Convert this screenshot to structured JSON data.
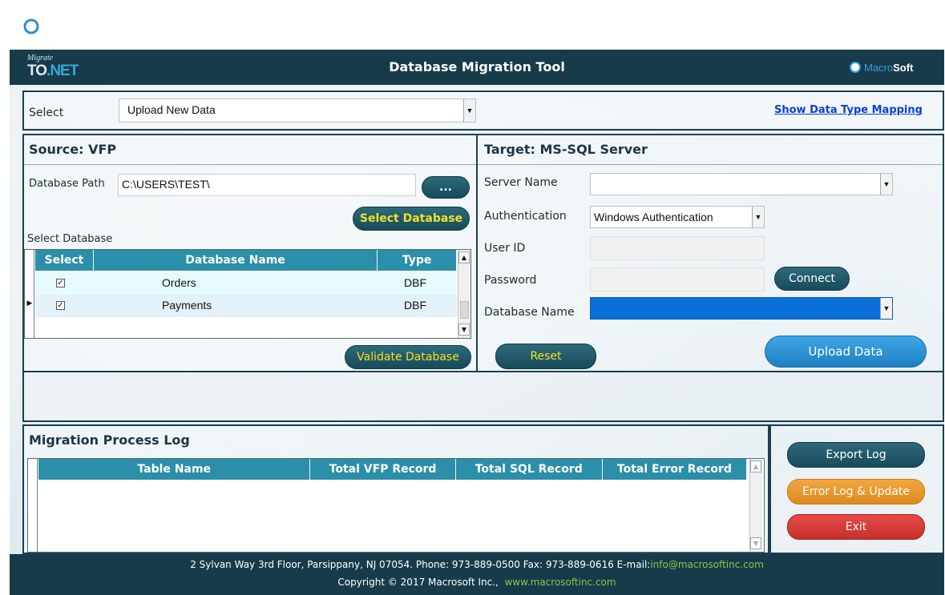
{
  "header": {
    "logo_line1": "Migrate",
    "logo_line2a": "TO",
    "logo_line2b": ".NET",
    "title": "Database Migration Tool",
    "brand_a": "Macro",
    "brand_b": "Soft"
  },
  "top_bar": {
    "select_label": "Select",
    "select_value": "Upload New Data",
    "mapping_link": "Show Data Type Mapping"
  },
  "source": {
    "title": "Source: VFP",
    "db_path_label": "Database Path",
    "db_path_value": "C:\\USERS\\TEST\\",
    "browse_label": "...",
    "select_db_button": "Select Database",
    "select_db_label": "Select Database",
    "columns": [
      "Select",
      "Database Name",
      "Type"
    ],
    "rows": [
      {
        "checked": true,
        "name": "Orders",
        "type": "DBF"
      },
      {
        "checked": true,
        "name": "Payments",
        "type": "DBF"
      }
    ],
    "check_glyph": "✓",
    "validate_button": "Validate Database"
  },
  "target": {
    "title": "Target: MS-SQL Server",
    "server_name_label": "Server Name",
    "server_name_value": "",
    "auth_label": "Authentication",
    "auth_value": "Windows Authentication",
    "user_id_label": "User ID",
    "password_label": "Password",
    "connect_button": "Connect",
    "db_name_label": "Database Name",
    "reset_button": "Reset",
    "upload_button": "Upload  Data"
  },
  "log": {
    "title": "Migration Process Log",
    "columns": [
      "Table Name",
      "Total VFP Record",
      "Total SQL Record",
      "Total Error Record"
    ]
  },
  "actions": {
    "export_log": "Export Log",
    "error_log_update": "Error Log & Update",
    "exit": "Exit"
  },
  "footer": {
    "line1": "2 Sylvan Way 3rd Floor, Parsippany, NJ 07054. Phone: 973-889-0500  Fax: 973-889-0616  E-mail:",
    "email": "info@macrosoftinc.com",
    "line2": "Copyright © 2017 Macrosoft Inc.,",
    "website": "www.macrosoftinc.com"
  },
  "colors": {
    "header_bg": "#173b4a",
    "grid_header": "#2b8fa9",
    "accent_blue": "#3aa0d8",
    "link": "#0b3fd8",
    "selected_db": "#0a6fd6"
  }
}
